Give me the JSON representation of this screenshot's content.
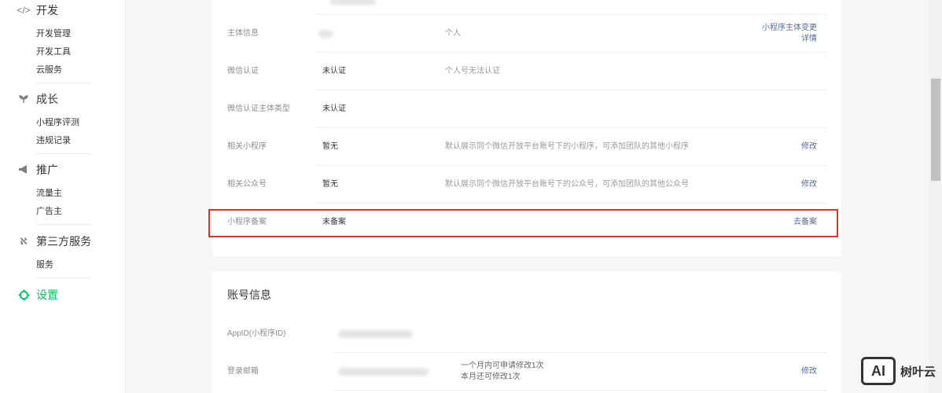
{
  "sidebar": {
    "groups": [
      {
        "title": "开发",
        "icon": "code-icon",
        "items": [
          "开发管理",
          "开发工具",
          "云服务"
        ]
      },
      {
        "title": "成长",
        "icon": "sprout-icon",
        "items": [
          "小程序评测",
          "违规记录"
        ]
      },
      {
        "title": "推广",
        "icon": "megaphone-icon",
        "items": [
          "流量主",
          "广告主"
        ]
      },
      {
        "title": "第三方服务",
        "icon": "third-party-icon",
        "items": [
          "服务"
        ]
      },
      {
        "title": "设置",
        "icon": "gear-icon",
        "items": []
      }
    ],
    "active_color": "#07c160"
  },
  "basic_info": {
    "rows": [
      {
        "label": "主体信息",
        "value": "",
        "desc": "个人",
        "action": "小程序主体变更",
        "action2": "详情"
      },
      {
        "label": "微信认证",
        "value": "未认证",
        "desc": "个人号无法认证",
        "action": ""
      },
      {
        "label": "微信认证主体类型",
        "value": "未认证",
        "desc": "",
        "action": ""
      },
      {
        "label": "相关小程序",
        "value": "暂无",
        "desc": "默认展示同个微信开放平台账号下的小程序，可添加团队的其他小程序",
        "action": "修改"
      },
      {
        "label": "相关公众号",
        "value": "暂无",
        "desc": "默认展示同个微信开放平台账号下的公众号，可添加团队的其他公众号",
        "action": "修改"
      },
      {
        "label": "小程序备案",
        "value": "未备案",
        "desc": "",
        "action": "去备案"
      }
    ]
  },
  "account_info": {
    "title": "账号信息",
    "appid_label": "AppID(小程序ID)",
    "email_label": "登录邮箱",
    "email_note_1": "一个月内可申请修改1次",
    "email_note_2": "本月还可修改1次",
    "email_action": "修改"
  },
  "watermark": {
    "logo": "AI",
    "text": "树叶云"
  },
  "colors": {
    "link": "#576b95",
    "highlight": "#d9342b"
  }
}
